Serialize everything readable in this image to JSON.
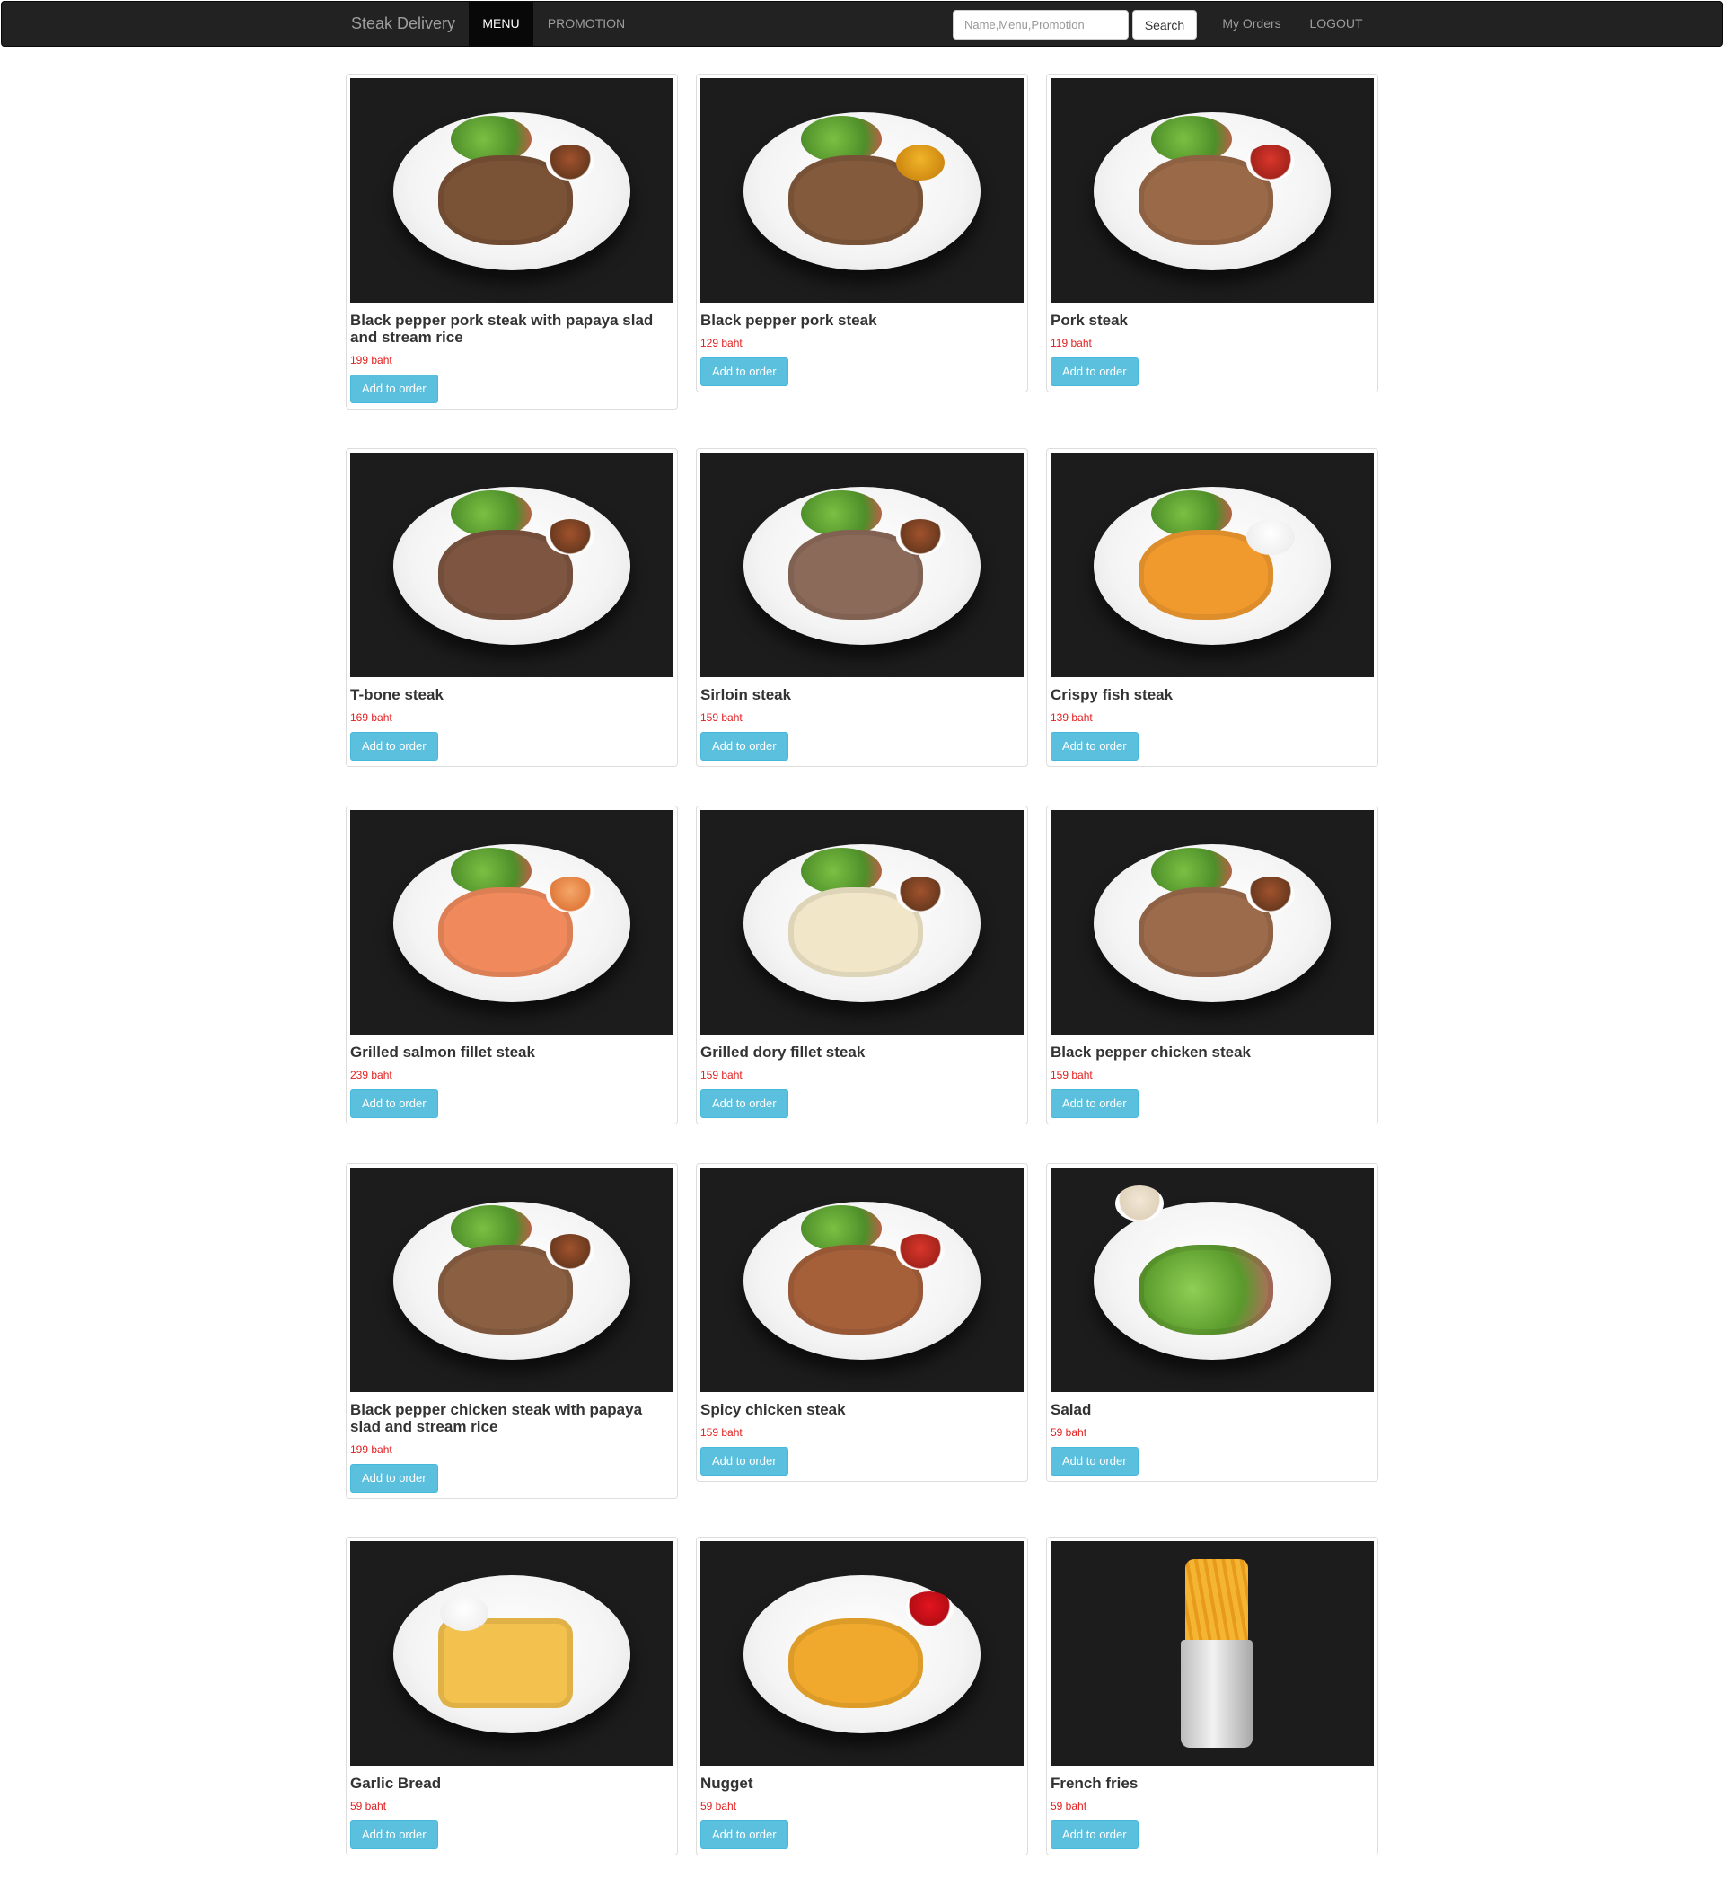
{
  "navbar": {
    "brand": "Steak Delivery",
    "menu_label": "MENU",
    "promotion_label": "PROMOTION",
    "search_placeholder": "Name,Menu,Promotion",
    "search_button": "Search",
    "my_orders_label": "My Orders",
    "logout_label": "LOGOUT"
  },
  "menu": {
    "items": [
      {
        "name": "Black pepper pork steak with papaya slad and stream rice",
        "price": "199 baht",
        "button": "Add to order",
        "image": "pork-steak-rice-plate-photo"
      },
      {
        "name": "Black pepper pork steak",
        "price": "129 baht",
        "button": "Add to order",
        "image": "pork-steak-fries-plate-photo"
      },
      {
        "name": "Pork steak",
        "price": "119 baht",
        "button": "Add to order",
        "image": "pork-steak-plate-photo"
      },
      {
        "name": "T-bone steak",
        "price": "169 baht",
        "button": "Add to order",
        "image": "t-bone-steak-plate-photo"
      },
      {
        "name": "Sirloin steak",
        "price": "159 baht",
        "button": "Add to order",
        "image": "sirloin-steak-plate-photo"
      },
      {
        "name": "Crispy fish steak",
        "price": "139 baht",
        "button": "Add to order",
        "image": "crispy-fish-plate-photo"
      },
      {
        "name": "Grilled salmon fillet steak",
        "price": "239 baht",
        "button": "Add to order",
        "image": "salmon-steak-plate-photo"
      },
      {
        "name": "Grilled dory fillet steak",
        "price": "159 baht",
        "button": "Add to order",
        "image": "dory-fillet-plate-photo"
      },
      {
        "name": "Black pepper chicken steak",
        "price": "159 baht",
        "button": "Add to order",
        "image": "chicken-steak-fries-plate-photo"
      },
      {
        "name": "Black pepper chicken steak with papaya slad and stream rice",
        "price": "199 baht",
        "button": "Add to order",
        "image": "chicken-steak-rice-plate-photo"
      },
      {
        "name": "Spicy chicken steak",
        "price": "159 baht",
        "button": "Add to order",
        "image": "spicy-chicken-plate-photo"
      },
      {
        "name": "Salad",
        "price": "59 baht",
        "button": "Add to order",
        "image": "salad-plate-photo"
      },
      {
        "name": "Garlic Bread",
        "price": "59 baht",
        "button": "Add to order",
        "image": "garlic-bread-plate-photo"
      },
      {
        "name": "Nugget",
        "price": "59 baht",
        "button": "Add to order",
        "image": "nugget-plate-photo"
      },
      {
        "name": "French fries",
        "price": "59 baht",
        "button": "Add to order",
        "image": "french-fries-bucket-photo"
      }
    ]
  },
  "colors": {
    "navbar_bg": "#222222",
    "price_red": "#e32020",
    "button_info": "#5bc0de",
    "photo_bg": "#1c1c1c"
  }
}
